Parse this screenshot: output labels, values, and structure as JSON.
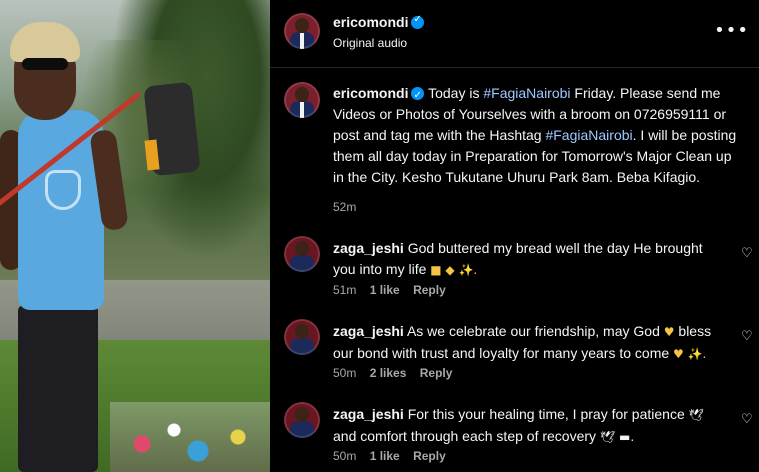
{
  "header": {
    "username": "ericomondi",
    "audio_label": "Original audio",
    "more_label": "•••"
  },
  "post": {
    "username": "ericomondi",
    "text_before": "Today is ",
    "tag1": "#FagiaNairobi",
    "text_middle": " Friday. Please send me Videos or Photos of Yourselves with a broom on 0726959111 or post and tag me with the Hashtag ",
    "tag2": "#FagiaNairobi",
    "text_after": ". I will be posting them all day today in Preparation for Tomorrow's Major Clean up in the City. Kesho Tukutane Uhuru Park 8am. Beba Kifagio.",
    "time": "52m"
  },
  "comments": [
    {
      "username": "zaga_jeshi",
      "text": "God buttered my bread well the day He brought you into my life",
      "emojis": "■ ◆ ✨.",
      "time": "51m",
      "likes": "1 like",
      "reply": "Reply"
    },
    {
      "username": "zaga_jeshi",
      "text_part1": "As we celebrate our friendship, may God ",
      "emoji1": "♥",
      "text_part2": " bless our bond with trust and loyalty for many years to come ",
      "emoji2": "♥ ✨.",
      "time": "50m",
      "likes": "2 likes",
      "reply": "Reply"
    },
    {
      "username": "zaga_jeshi",
      "text_part1": "For this your healing time, I pray for patience ",
      "emoji1": "🕊",
      "text_part2": " and comfort through each step of recovery ",
      "emoji2": "🕊 ▬.",
      "time": "50m",
      "likes": "1 like",
      "reply": "Reply"
    }
  ],
  "colors": {
    "background": "#000000",
    "text": "#f5f5f5",
    "muted": "#a8a8a8",
    "hashtag": "#9ec9ff",
    "verified": "#0095f6"
  },
  "icons": {
    "verified": "verified-badge-icon",
    "like": "heart-outline-icon",
    "more": "more-options-icon"
  }
}
